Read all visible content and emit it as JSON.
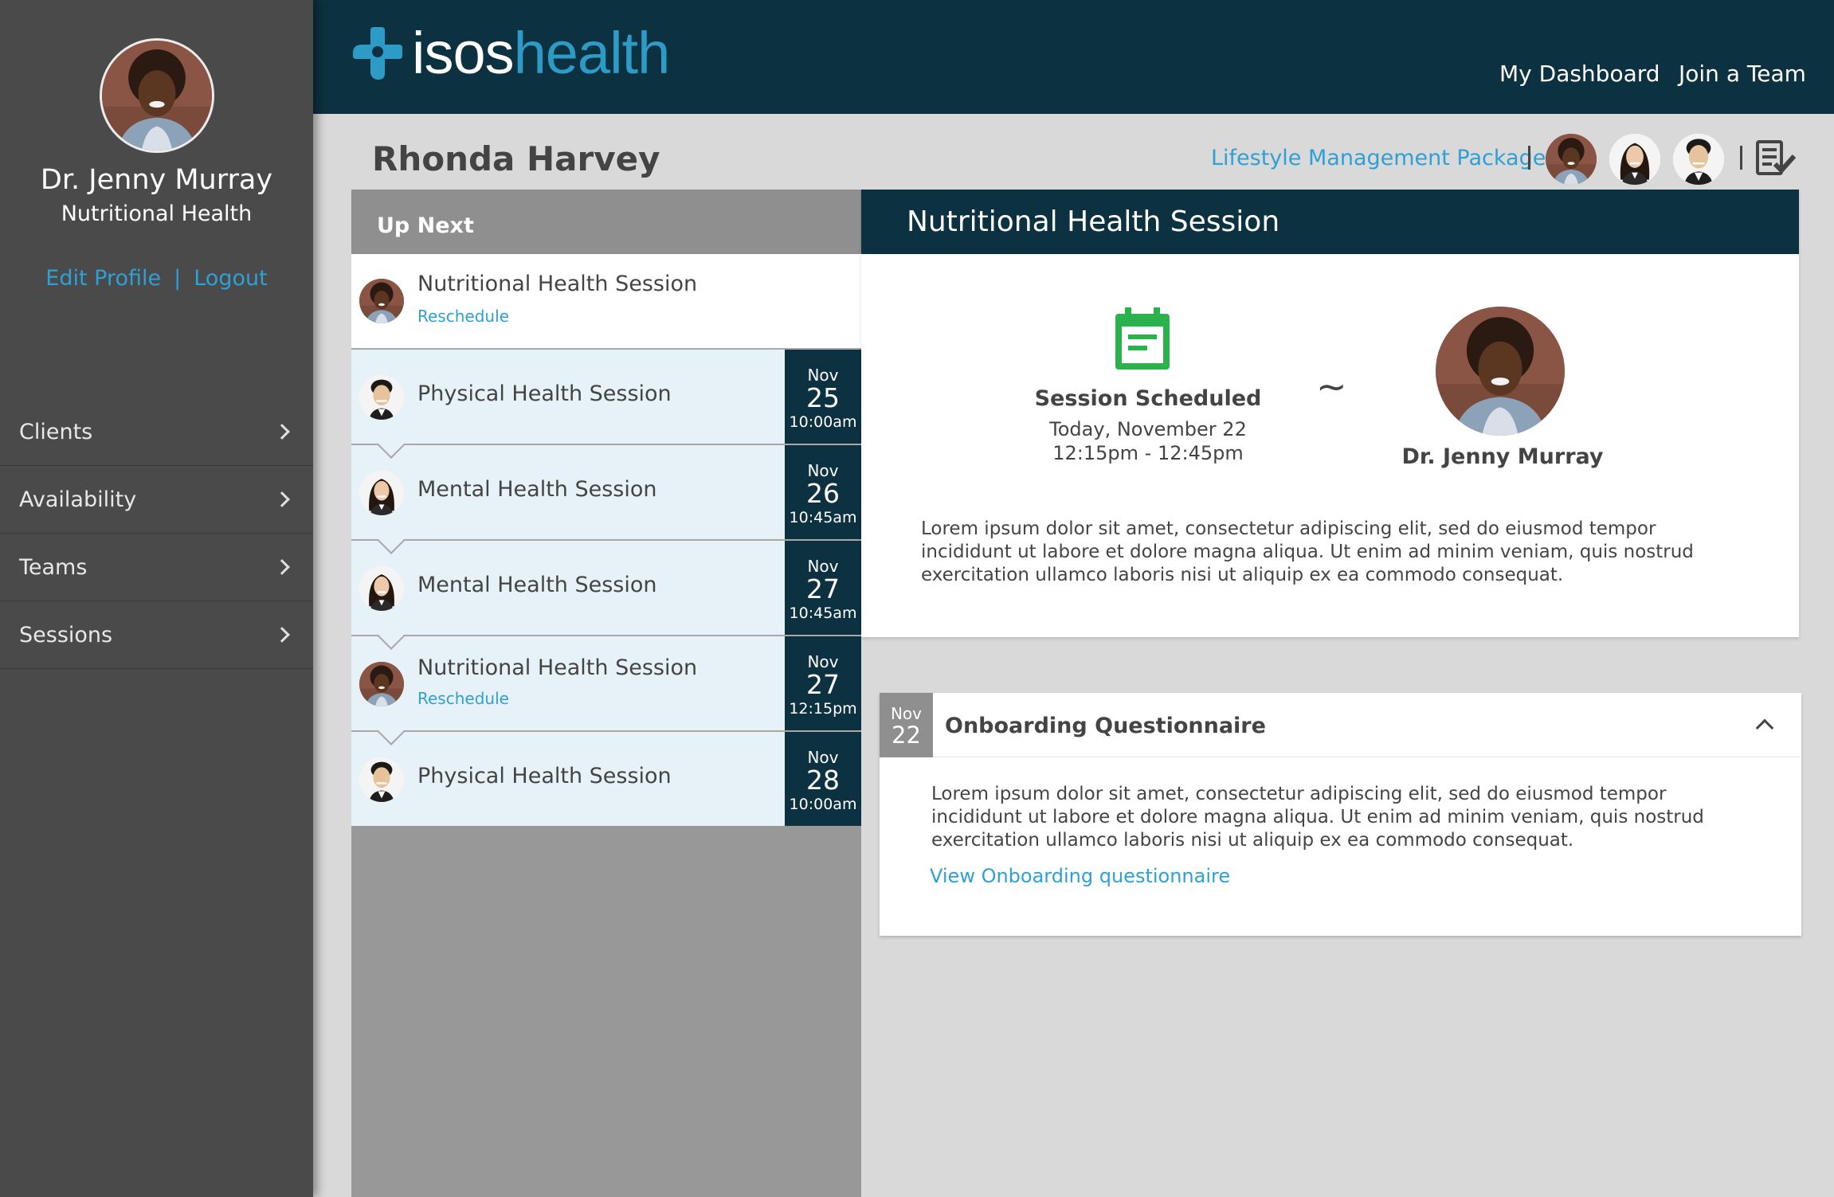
{
  "app": {
    "logo_word1": "isos",
    "logo_word2": "health",
    "brand_navy": "#0c3140",
    "brand_blue": "#2d9bc6",
    "link_blue": "#2fa0d6"
  },
  "sidebar": {
    "profile_name": "Dr. Jenny Murray",
    "profile_role": "Nutritional Health",
    "edit_profile": "Edit Profile",
    "link_separator": "|",
    "logout": "Logout",
    "nav": [
      {
        "label": "Clients"
      },
      {
        "label": "Availability"
      },
      {
        "label": "Teams"
      },
      {
        "label": "Sessions"
      }
    ]
  },
  "header": {
    "my_dashboard": "My Dashboard",
    "join_team": "Join a Team"
  },
  "client": {
    "name": "Rhonda Harvey",
    "package": "Lifestyle Management Package"
  },
  "up_next": {
    "title": "Up Next",
    "first": {
      "title": "Nutritional Health Session",
      "action": "Reschedule"
    },
    "sessions": [
      {
        "title": "Physical Health Session",
        "month": "Nov",
        "day": "25",
        "time": "10:00am",
        "avatar": "asian-man-avatar"
      },
      {
        "title": "Mental Health Session",
        "month": "Nov",
        "day": "26",
        "time": "10:45am",
        "avatar": "woman-dark-hair-avatar"
      },
      {
        "title": "Mental Health Session",
        "month": "Nov",
        "day": "27",
        "time": "10:45am",
        "avatar": "woman-dark-hair-avatar"
      },
      {
        "title": "Nutritional Health Session",
        "action": "Reschedule",
        "month": "Nov",
        "day": "27",
        "time": "12:15pm",
        "avatar": "doctor-avatar"
      },
      {
        "title": "Physical Health Session",
        "month": "Nov",
        "day": "28",
        "time": "10:00am",
        "avatar": "asian-man-avatar"
      }
    ]
  },
  "detail": {
    "title": "Nutritional Health Session",
    "status": "Session Scheduled",
    "date": "Today, November 22",
    "time": "12:15pm - 12:45pm",
    "separator": "~",
    "provider": "Dr. Jenny Murray",
    "description": "Lorem ipsum dolor sit amet, consectetur adipiscing elit, sed do eiusmod tempor incididunt ut labore et dolore magna aliqua. Ut enim ad minim veniam, quis nostrud exercitation ullamco laboris nisi ut aliquip ex ea commodo consequat."
  },
  "questionnaire": {
    "month": "Nov",
    "day": "22",
    "title": "Onboarding Questionnaire",
    "body": "Lorem ipsum dolor sit amet, consectetur adipiscing elit, sed do eiusmod tempor incididunt ut labore et dolore magna aliqua. Ut enim ad minim veniam, quis nostrud exercitation ullamco laboris nisi ut aliquip ex ea commodo consequat.",
    "link": "View Onboarding questionnaire"
  }
}
